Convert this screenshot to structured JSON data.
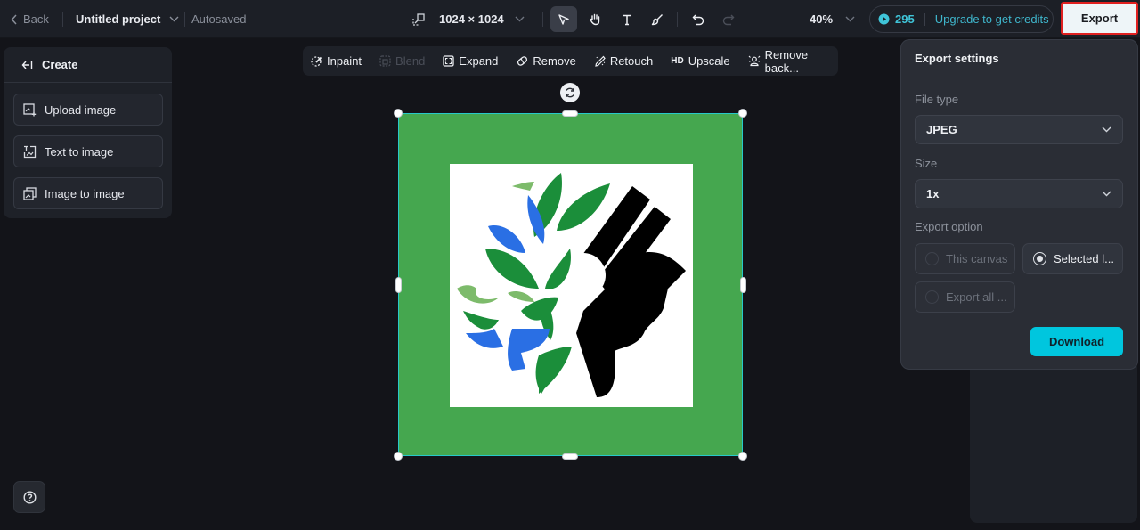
{
  "topbar": {
    "back_label": "Back",
    "project_title": "Untitled project",
    "save_status": "Autosaved",
    "canvas_size": "1024 × 1024",
    "zoom_level": "40%",
    "credits_count": "295",
    "upgrade_label": "Upgrade to get credits",
    "export_label": "Export"
  },
  "tools": [
    {
      "name": "select",
      "active": true
    },
    {
      "name": "hand",
      "active": false
    },
    {
      "name": "text",
      "active": false
    },
    {
      "name": "brush",
      "active": false
    },
    {
      "name": "undo",
      "active": false
    },
    {
      "name": "redo",
      "active": false,
      "disabled": true
    }
  ],
  "create_panel": {
    "title": "Create",
    "items": [
      {
        "label": "Upload image",
        "icon": "upload-image-icon"
      },
      {
        "label": "Text to image",
        "icon": "text-to-image-icon"
      },
      {
        "label": "Image to image",
        "icon": "image-to-image-icon"
      }
    ]
  },
  "edit_toolbar": {
    "items": [
      {
        "label": "Inpaint",
        "icon": "inpaint-icon",
        "disabled": false
      },
      {
        "label": "Blend",
        "icon": "blend-icon",
        "disabled": true
      },
      {
        "label": "Expand",
        "icon": "expand-icon",
        "disabled": false
      },
      {
        "label": "Remove",
        "icon": "eraser-icon",
        "disabled": false
      },
      {
        "label": "Retouch",
        "icon": "retouch-icon",
        "disabled": false
      },
      {
        "label": "Upscale",
        "icon_text": "HD",
        "disabled": false
      },
      {
        "label": "Remove back...",
        "icon": "remove-background-icon",
        "disabled": false
      }
    ]
  },
  "export_panel": {
    "title": "Export settings",
    "file_type_label": "File type",
    "file_type_value": "JPEG",
    "size_label": "Size",
    "size_value": "1x",
    "export_option_label": "Export option",
    "options": [
      {
        "label": "This canvas",
        "selected": false
      },
      {
        "label": "Selected l...",
        "selected": true
      },
      {
        "label": "Export all ...",
        "selected": false
      }
    ],
    "download_label": "Download"
  },
  "colors": {
    "accent": "#00c6de",
    "canvas_bg": "#45a74f",
    "selection": "#27c9c9",
    "highlight_border": "#e02020"
  }
}
